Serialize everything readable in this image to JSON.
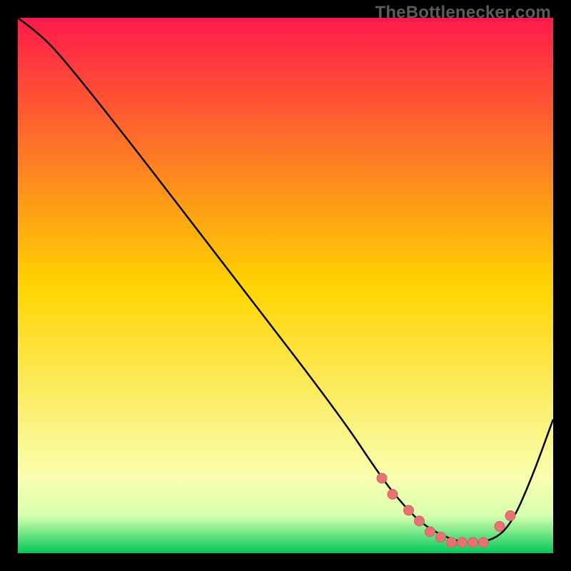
{
  "watermark": "TheBottlenecker.com",
  "colors": {
    "top": "#ff1a4b",
    "mid": "#ffd400",
    "green_light": "#d8ffae",
    "green_deep": "#00c85a",
    "curve": "#000000",
    "marker_fill": "#e57373",
    "marker_stroke": "#d46060"
  },
  "chart_data": {
    "type": "line",
    "title": "",
    "xlabel": "",
    "ylabel": "",
    "xlim": [
      0,
      100
    ],
    "ylim": [
      0,
      100
    ],
    "series": [
      {
        "name": "curve",
        "x": [
          0,
          4,
          8,
          20,
          40,
          60,
          68,
          72,
          76,
          82,
          88,
          92,
          96,
          100
        ],
        "y": [
          100,
          97,
          93,
          78,
          52,
          26,
          14,
          9,
          5,
          2,
          2,
          5,
          14,
          25
        ]
      }
    ],
    "markers": {
      "x": [
        68,
        70,
        73,
        75,
        77,
        79,
        81,
        83,
        85,
        87,
        90,
        92
      ],
      "y": [
        14,
        11,
        8,
        6,
        4,
        3,
        2,
        2,
        2,
        2,
        5,
        7
      ]
    }
  }
}
